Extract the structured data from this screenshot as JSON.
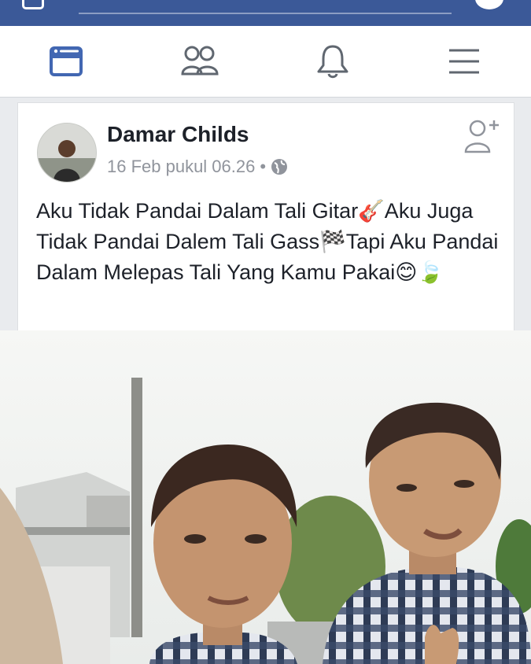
{
  "topbar": {
    "camera_icon": "camera-icon",
    "search_icon": "search-icon",
    "messenger_icon": "messenger-icon",
    "color": "#3b5998"
  },
  "nav": {
    "items": [
      {
        "name": "news-feed",
        "icon": "newsfeed-icon",
        "active": true
      },
      {
        "name": "friends",
        "icon": "friends-icon"
      },
      {
        "name": "notifications",
        "icon": "bell-icon"
      },
      {
        "name": "menu",
        "icon": "hamburger-icon"
      }
    ],
    "active_color": "#4267b2"
  },
  "post": {
    "author": "Damar Childs",
    "timestamp": "16 Feb pukul 06.26",
    "separator": "•",
    "privacy_icon": "globe-icon",
    "add_friend_icon": "add-friend-icon",
    "text": "Aku Tidak Pandai Dalam Tali Gitar🎸Aku Juga Tidak Pandai Dalem Tali Gass🏁Tapi Aku Pandai Dalam Melepas Tali Yang Kamu Pakai😊🍃",
    "photo": "photo of two boys taking a selfie outdoors"
  }
}
